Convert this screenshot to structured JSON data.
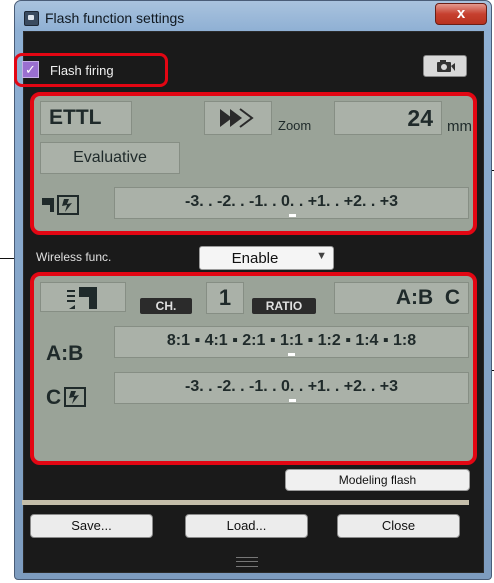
{
  "window": {
    "title": "Flash function settings",
    "close_label": "x"
  },
  "flash_firing": {
    "label": "Flash firing",
    "checked": true
  },
  "flash": {
    "mode": "ETTL",
    "zoom_label": "Zoom",
    "zoom_value": "24",
    "zoom_unit": "mm",
    "metering": "Evaluative",
    "fec_scale": "-3. . -2. . -1. . 0. . +1. . +2. . +3",
    "fec_value": 0
  },
  "wireless": {
    "label": "Wireless func.",
    "value": "Enable",
    "channel_label": "CH.",
    "channel_value": "1",
    "ratio_label": "RATIO",
    "ratio_mode": "A:B  C",
    "ab_label": "A:B",
    "ab_scale": "8:1 ▪ 4:1 ▪ 2:1 ▪ 1:1 ▪ 1:2 ▪ 1:4 ▪ 1:8",
    "c_label": "C",
    "c_scale": "-3. . -2. . -1. . 0. . +1. . +2. . +3"
  },
  "buttons": {
    "modeling_flash": "Modeling flash",
    "save": "Save...",
    "load": "Load...",
    "close": "Close"
  },
  "colors": {
    "highlight": "#e30613",
    "lcd": "#9aa398"
  },
  "icons": [
    "camera-settings-icon",
    "flash-fec-icon",
    "high-speed-sync-icon",
    "wireless-flash-icon"
  ]
}
